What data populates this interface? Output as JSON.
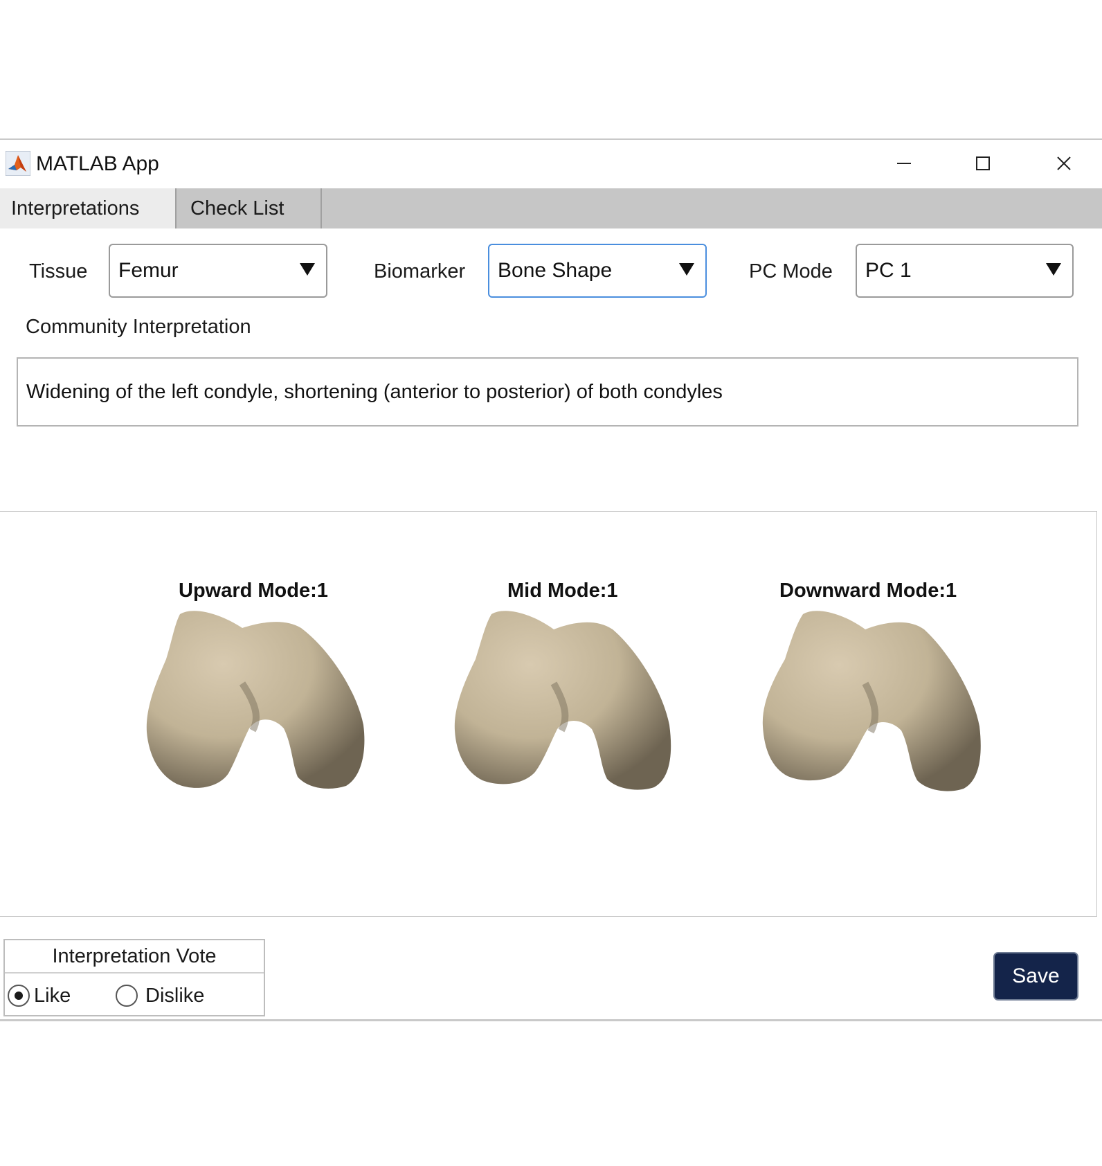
{
  "window": {
    "title": "MATLAB App",
    "controls": {
      "minimize": "minimize-icon",
      "maximize": "maximize-icon",
      "close": "close-icon"
    }
  },
  "tabs": [
    {
      "label": "Interpretations",
      "active": true
    },
    {
      "label": "Check List",
      "active": false
    }
  ],
  "selectors": {
    "tissue": {
      "label": "Tissue",
      "value": "Femur"
    },
    "biomarker": {
      "label": "Biomarker",
      "value": "Bone Shape"
    },
    "pc_mode": {
      "label": "PC Mode",
      "value": "PC 1"
    }
  },
  "interpretation": {
    "label": "Community Interpretation",
    "text": "Widening of the left condyle, shortening (anterior to posterior) of both condyles"
  },
  "plots": [
    {
      "title": "Upward Mode:1"
    },
    {
      "title": "Mid Mode:1"
    },
    {
      "title": "Downward Mode:1"
    }
  ],
  "vote": {
    "title": "Interpretation Vote",
    "options": [
      {
        "label": "Like",
        "selected": true
      },
      {
        "label": "Dislike",
        "selected": false
      }
    ]
  },
  "save_label": "Save",
  "colors": {
    "accent": "#14244a",
    "focus": "#4a8ede",
    "bone": "#cdbfa4",
    "tabbar": "#c6c6c6"
  }
}
